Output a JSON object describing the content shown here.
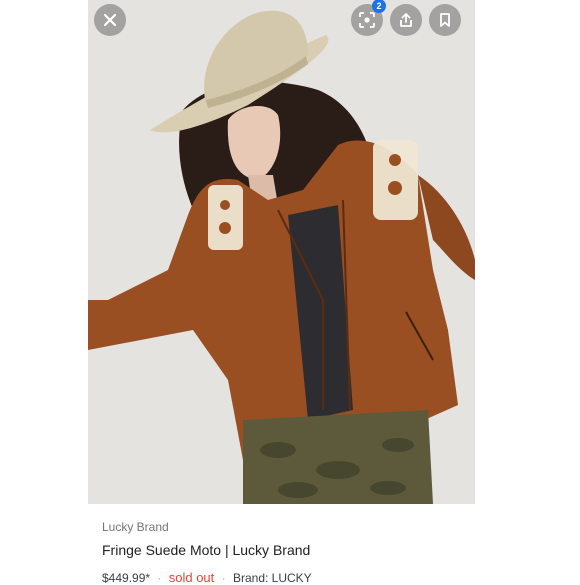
{
  "controls": {
    "close_icon": "close-icon",
    "lens_icon": "lens-icon",
    "lens_badge": "2",
    "share_icon": "share-icon",
    "bookmark_icon": "bookmark-icon"
  },
  "product": {
    "source": "Lucky Brand",
    "title": "Fringe Suede Moto | Lucky Brand",
    "price": "$449.99*",
    "status": "sold out",
    "brand": "Brand: LUCKY"
  },
  "colors": {
    "jacket": "#9a4f22",
    "hat": "#d9cdb2",
    "status": "#ea4335",
    "badge": "#1a73e8"
  }
}
